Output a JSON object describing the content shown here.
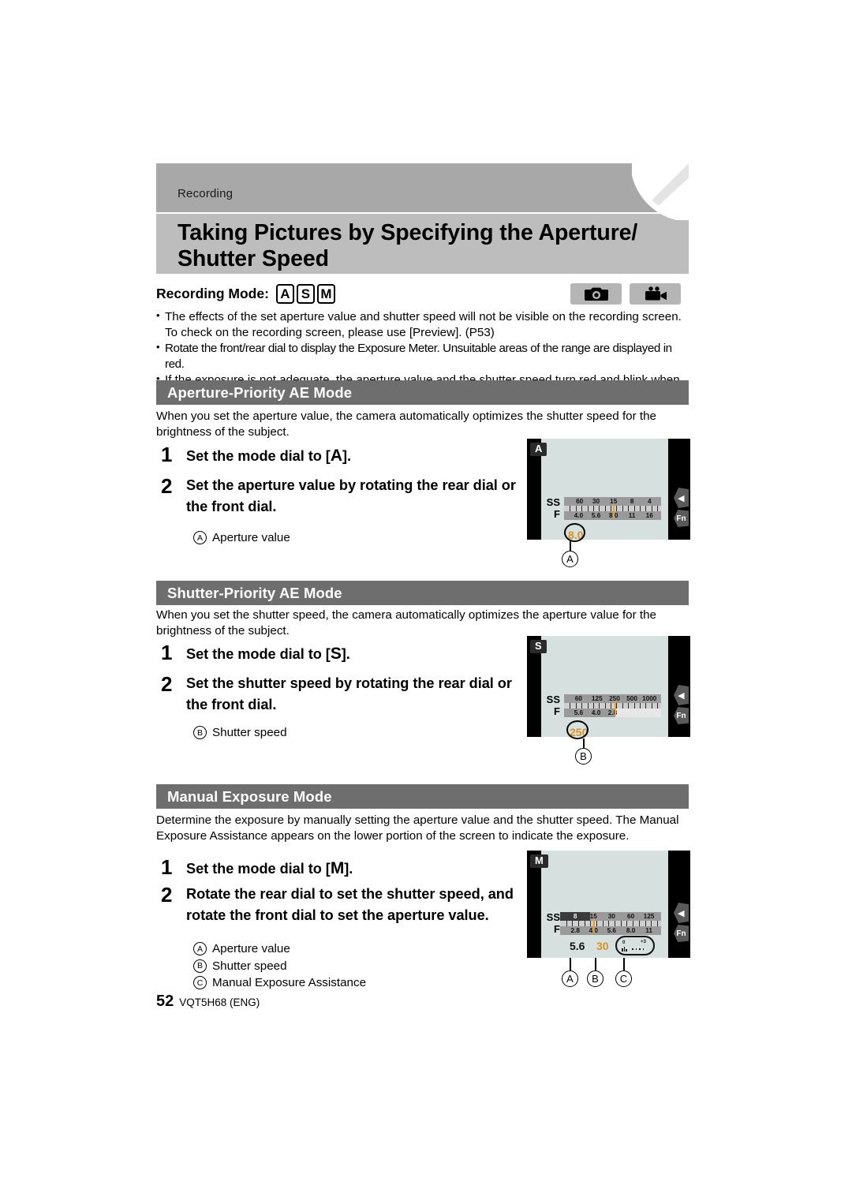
{
  "header": {
    "chapter": "Recording",
    "title": "Taking Pictures by Specifying the Aperture/ Shutter Speed"
  },
  "recording_mode": {
    "label": "Recording Mode:",
    "modes": [
      "A",
      "S",
      "M"
    ],
    "badges": [
      "photo-camera-icon",
      "video-camera-icon"
    ]
  },
  "intro_bullets": [
    "The effects of the set aperture value and shutter speed will not be visible on the recording screen. To check on the recording screen, please use [Preview]. (P53)",
    "Rotate the front/rear dial to display the Exposure Meter. Unsuitable areas of the range are displayed in red.",
    "If the exposure is not adequate, the aperture value and the shutter speed turn red and blink when the shutter button is pressed halfway."
  ],
  "sections": [
    {
      "id": "aperture",
      "title": "Aperture-Priority AE Mode",
      "intro": "When you set the aperture value, the camera automatically optimizes the shutter speed for the brightness of the subject.",
      "steps": [
        {
          "num": "1",
          "text": "Set the mode dial to [",
          "emph": "A",
          "text_after": "]."
        },
        {
          "num": "2",
          "text": "Set the aperture value by rotating the rear dial or the front dial.",
          "emph": "",
          "text_after": ""
        }
      ],
      "legend": [
        {
          "mark": "A",
          "label": "Aperture value"
        }
      ],
      "screen": {
        "mode_badge": "A",
        "chevron_icon": "chevron-left-icon",
        "fn_label": "Fn",
        "meter": {
          "ss_label": "SS",
          "f_label": "F",
          "ss_values": [
            "60",
            "30",
            "15",
            "8",
            "4"
          ],
          "f_values": [
            "4.0",
            "5.6",
            "8.0",
            "11",
            "16"
          ],
          "cursor_percent": 50,
          "dark_percent": 0,
          "f_fill_percent": 100
        },
        "readout": {
          "value": "8.0",
          "color": "#d89220",
          "highlighted": true
        },
        "callout": "A"
      }
    },
    {
      "id": "shutter",
      "title": "Shutter-Priority AE Mode",
      "intro": "When you set the shutter speed, the camera automatically optimizes the aperture value for the brightness of the subject.",
      "steps": [
        {
          "num": "1",
          "text": "Set the mode dial to [",
          "emph": "S",
          "text_after": "]."
        },
        {
          "num": "2",
          "text": "Set the shutter speed by rotating the rear dial or the front dial.",
          "emph": "",
          "text_after": ""
        }
      ],
      "legend": [
        {
          "mark": "B",
          "label": "Shutter speed"
        }
      ],
      "screen": {
        "mode_badge": "S",
        "chevron_icon": "chevron-left-icon",
        "fn_label": "Fn",
        "meter": {
          "ss_label": "SS",
          "f_label": "F",
          "ss_values": [
            "60",
            "125",
            "250",
            "500",
            "1000"
          ],
          "f_values": [
            "5.6",
            "4.0",
            "2.8"
          ],
          "cursor_percent": 50,
          "dark_percent": 0,
          "f_fill_percent": 53
        },
        "readout": {
          "value": "250",
          "color": "#d89220",
          "highlighted": true
        },
        "callout": "B"
      }
    },
    {
      "id": "manual",
      "title": "Manual Exposure Mode",
      "intro": "Determine the exposure by manually setting the aperture value and the shutter speed. The Manual Exposure Assistance appears on the lower portion of the screen to indicate the exposure.",
      "steps": [
        {
          "num": "1",
          "text": "Set the mode dial to [",
          "emph": "M",
          "text_after": "]."
        },
        {
          "num": "2",
          "text": "Rotate the rear dial to set the shutter speed, and rotate the front dial to set the aperture value.",
          "emph": "",
          "text_after": ""
        }
      ],
      "legend": [
        {
          "mark": "A",
          "label": "Aperture value"
        },
        {
          "mark": "B",
          "label": "Shutter speed"
        },
        {
          "mark": "C",
          "label": "Manual Exposure Assistance"
        }
      ],
      "screen": {
        "mode_badge": "M",
        "chevron_icon": "chevron-left-icon",
        "fn_label": "Fn",
        "meter": {
          "ss_label": "SS",
          "f_label": "F",
          "ss_values": [
            "8",
            "15",
            "30",
            "60",
            "125"
          ],
          "f_values": [
            "2.8",
            "4.0",
            "5.6",
            "8.0",
            "11"
          ],
          "cursor_percent": 33,
          "dark_percent": 30,
          "f_fill_percent": 100
        },
        "readouts": [
          {
            "value": "5.6",
            "color": "#111111",
            "callout": "A"
          },
          {
            "value": "30",
            "color": "#d89220",
            "callout": "B"
          }
        ],
        "assistance": {
          "zero_label": "0",
          "plus_label": "+3",
          "callout": "C"
        }
      }
    }
  ],
  "footer": {
    "page_number": "52",
    "code": "VQT5H68 (ENG)"
  },
  "colors": {
    "header_top": "#a8a8a8",
    "header_body": "#bdbdbd",
    "section_bar": "#6e6e6e",
    "lcd": "#d6e0de",
    "amber": "#d89220",
    "meter_band": "#9a9a9a"
  }
}
